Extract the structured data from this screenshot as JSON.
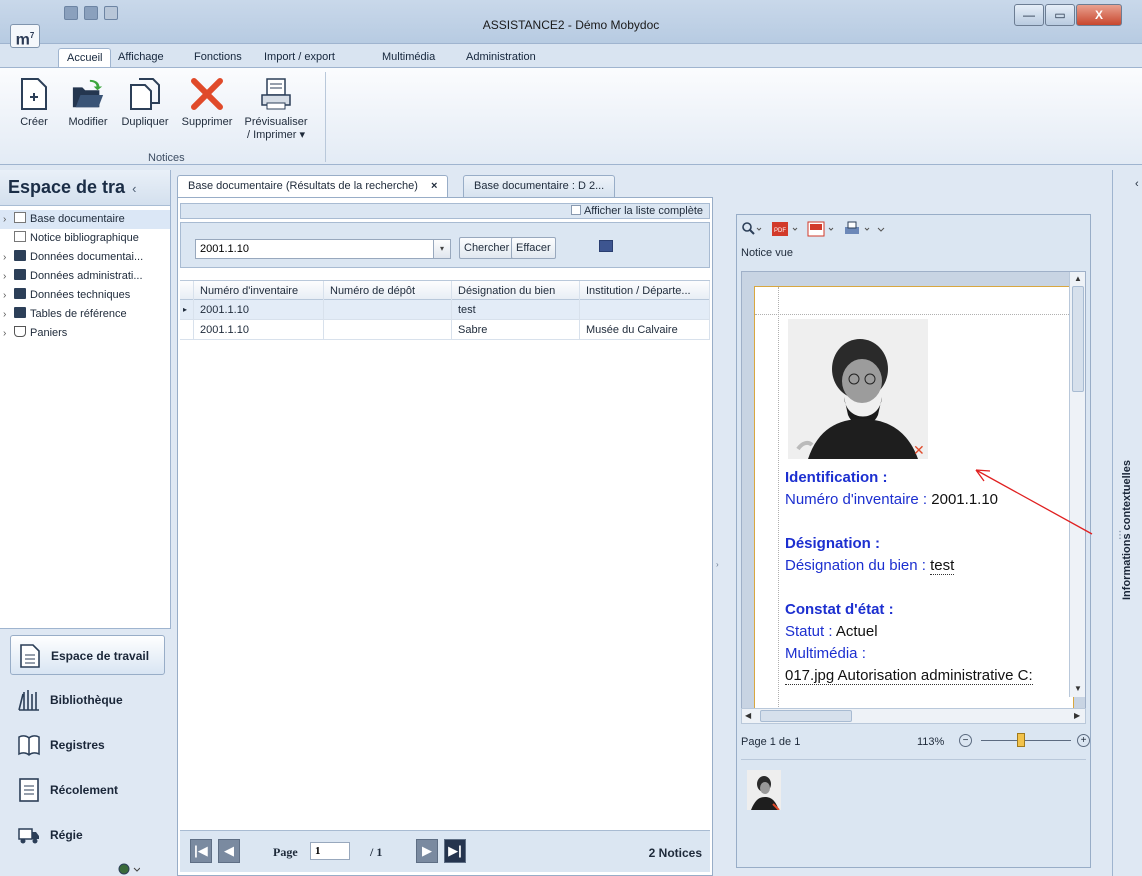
{
  "window": {
    "title": "ASSISTANCE2 - Démo Mobydoc",
    "logo": "m",
    "logo_sup": "7",
    "minimize": "—",
    "maximize": "▭",
    "close": "X"
  },
  "ribbon_tabs": [
    "Accueil",
    "Affichage",
    "Fonctions",
    "Import / export",
    "Multimédia",
    "Administration"
  ],
  "ribbon": {
    "buttons": [
      {
        "label": "Créer",
        "icon": "new-doc-icon"
      },
      {
        "label": "Modifier",
        "icon": "open-folder-icon"
      },
      {
        "label": "Dupliquer",
        "icon": "duplicate-icon"
      },
      {
        "label": "Supprimer",
        "icon": "delete-x-icon"
      },
      {
        "label": "Prévisualiser",
        "label2": "/ Imprimer",
        "dropdown": "▾",
        "icon": "printer-icon"
      }
    ],
    "group_label": "Notices"
  },
  "left_panel": {
    "title": "Espace de tra",
    "collapse": "‹",
    "tree": [
      {
        "label": "Base documentaire",
        "icon": "doc",
        "expander": "›",
        "selected": true
      },
      {
        "label": "Notice bibliographique",
        "icon": "doc",
        "expander": ""
      },
      {
        "label": "Données documentai...",
        "icon": "folder",
        "expander": "›"
      },
      {
        "label": "Données administrati...",
        "icon": "folder",
        "expander": "›"
      },
      {
        "label": "Données techniques",
        "icon": "folder",
        "expander": "›"
      },
      {
        "label": "Tables de référence",
        "icon": "folder",
        "expander": "›"
      },
      {
        "label": "Paniers",
        "icon": "basket",
        "expander": "›"
      }
    ],
    "nav": [
      {
        "label": "Espace de travail",
        "active": true
      },
      {
        "label": "Bibliothèque"
      },
      {
        "label": "Registres"
      },
      {
        "label": "Récolement"
      },
      {
        "label": "Régie"
      }
    ]
  },
  "doc_tabs": [
    {
      "label": "Base documentaire (Résultats de la recherche)",
      "close": "×",
      "active": true
    },
    {
      "label": "Base documentaire : D 2...",
      "active": false
    }
  ],
  "center": {
    "full_list_label": "Afficher la liste complète",
    "search_value": "2001.1.10",
    "search_dropdown": "▾",
    "search_button": "Chercher",
    "clear_button": "Effacer",
    "columns": [
      "Numéro d'inventaire",
      "Numéro de dépôt",
      "Désignation du bien",
      "Institution / Départe..."
    ],
    "rows": [
      {
        "indicator": "▸",
        "inventaire": "2001.1.10",
        "depot": "",
        "designation": "test",
        "institution": ""
      },
      {
        "indicator": "",
        "inventaire": "2001.1.10",
        "depot": "",
        "designation": "Sabre",
        "institution": "Musée du Calvaire"
      }
    ],
    "pager": {
      "page_label": "Page",
      "page_value": "1",
      "page_total": "/ 1",
      "count": "2 Notices",
      "first": "|◀",
      "prev": "◀",
      "next": "▶",
      "last": "▶|"
    }
  },
  "preview": {
    "notice_vue": "Notice vue",
    "sections": {
      "identification": "Identification :",
      "inventaire_key": "Numéro d'inventaire :",
      "inventaire_val": "2001.1.10",
      "designation_h": "Désignation :",
      "designation_key": "Désignation du bien :",
      "designation_val": "test",
      "constat_h": "Constat d'état :",
      "statut_key": "Statut :",
      "statut_val": "Actuel",
      "multimedia_key": "Multimédia :",
      "multimedia_val": "017.jpg Autorisation administrative C:"
    },
    "page_info": "Page 1 de 1",
    "zoom": "113%",
    "zoom_level_fraction": 0.42,
    "zoom_minus": "−",
    "zoom_plus": "+"
  },
  "right_panel": {
    "label": "Informations contextuelles",
    "collapse": "‹"
  },
  "colors": {
    "accent_blue": "#1c2fd0",
    "annotation_red": "#e02020",
    "delete_red": "#e04a2a"
  }
}
